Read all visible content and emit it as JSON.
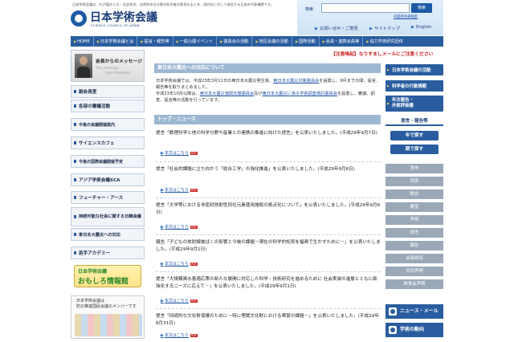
{
  "header": {
    "description": "日本学術会議は、わが国の人文・社会科学、自然科学全分野の科学者の意見をまとめ、国内外に対して発信する日本の代表機関です。",
    "logo_title": "日本学術会議",
    "logo_subtitle": "SCIENCE COUNCIL OF JAPAN",
    "search_label": "検索",
    "search_placeholder": "",
    "search_button": "検索",
    "inner_search_link": "内閣府共通検索",
    "links": [
      "お問い合せ・ご意見",
      "サイトマップ",
      "English"
    ]
  },
  "nav": {
    "items": [
      "HOME",
      "日本学術会議とは",
      "提言・報告等",
      "一般公開イベント",
      "委員会の活動",
      "地区会議の活動",
      "国際活動",
      "会員・連携会員等",
      "協力学術研究団体"
    ]
  },
  "notice": "【注意喚起】なりすましメールにご注意ください",
  "sidebar": {
    "message": {
      "title": "会長からのメッセージ",
      "en_line1": "The message",
      "en_line2": "from President"
    },
    "items": [
      "副会長室",
      "各部の審議活動",
      "今後の会議開催案内",
      "サイエンスカフェ",
      "今後の国際会議開催予定",
      "アジア学術会議SCA",
      "フューチャー・アース",
      "持続可能な社会に関する日韓会議",
      "東日本大震災への対応",
      "若手アカデミー"
    ],
    "banner_omoshiro": {
      "small": "日本学術会議",
      "big": "おもしろ情報館"
    },
    "banner_bousai": {
      "line1": "日本学術会議は",
      "line2": "防災推進国民会議のメンバーです"
    }
  },
  "main": {
    "quake_heading": "東日本大震災への対応について",
    "quake_text_1": "日本学術会議では、平成23年3月11日の東日本大震災発生後、",
    "quake_link_1": "東日本大震災対策委員会",
    "quake_text_2": "を設置し、9月までの間、提言、報告等を取りまとめました。",
    "quake_text_3": "平成23年10月以降は、",
    "quake_link_2": "東日本大震災復興支援委員会",
    "quake_text_4": "及び",
    "quake_link_3": "東日本大震災に係る学術調査検討委員会",
    "quake_text_5": "を設置し、審議、調査、提言等の活動を行っています。",
    "news_heading": "トップ・ニュース",
    "news": [
      {
        "title": "提言「数理科学と他の科学分野や産業との連携の推進に向けた提言」を公表いたしました。(平成29年9月7日)",
        "link": "本文はこちら"
      },
      {
        "title": "提言「社会的課題に立ち向かう「総合工学」の強化推進」を公表いたしました。(平成29年9月6日)",
        "link": "本文はこちら"
      },
      {
        "title": "提言「大学等における非密封放射性同位元素使用施設の拠点化について」を公表いたしました。(平成29年9月6日)",
        "link": "本文はこちら"
      },
      {
        "title": "報告「子どもの放射線被ばくの影響と今後の課題－現在の科学的知見を福島で生かすために－」を公表いたしました。(平成29年9月1日)",
        "link": "本文はこちら"
      },
      {
        "title": "提言「大規模黒水害適応策の新たな展開に対応した科学・技術研究を進めるために 社会実装の進展とともに新強化する二ーズに応えて－」を公表いたしました。(平成29年9月1日)",
        "link": "本文はこちら"
      },
      {
        "title": "提言「持続的な文化財保護のために－特に埋蔵文化財における喫緊の課題－」を公表いたしました。(平成29年8月31日)",
        "link": "本文はこちら"
      }
    ],
    "pdf_label": "PDF"
  },
  "right": {
    "buttons": [
      "日本学術会議の活動",
      "科学者の行動規範"
    ],
    "calendar": [
      "年次報告・",
      "外部評価書"
    ],
    "reports_head": "提言・報告等",
    "search_year": "年で探す",
    "search_period": "期で探す",
    "categories": [
      "答申",
      "回答",
      "勧告",
      "要望",
      "声明",
      "提言",
      "報告",
      "会長談話",
      "共同声明",
      "幹事会声明"
    ],
    "news_mail": "ニュース・メール",
    "trend": "学術の動向"
  }
}
